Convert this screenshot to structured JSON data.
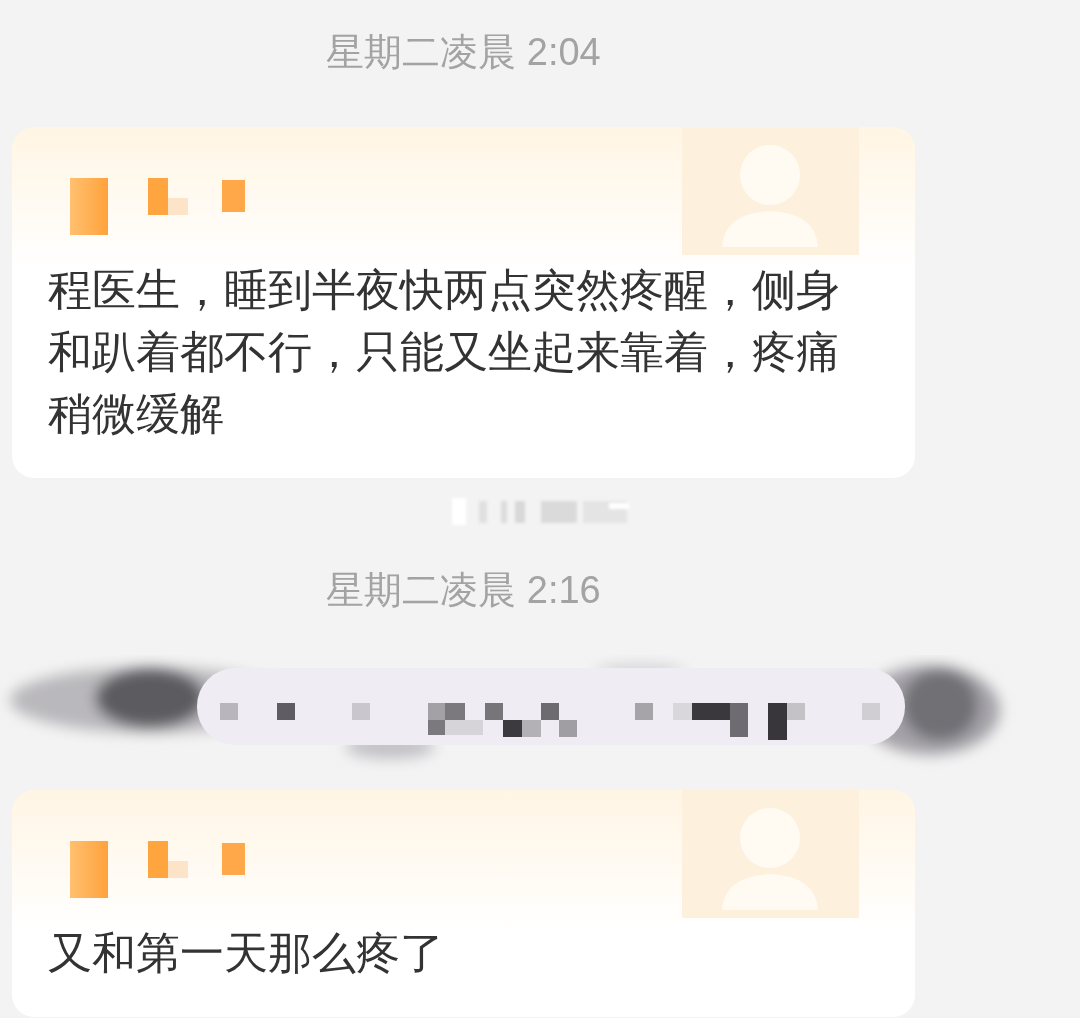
{
  "chat": {
    "items": [
      {
        "kind": "timestamp",
        "text": "星期二凌晨 2:04"
      },
      {
        "kind": "message",
        "text": "程医生，睡到半夜快两点突然疼醒，侧身和趴着都不行，只能又坐起来靠着，疼痛稍微缓解"
      },
      {
        "kind": "redacted_notice"
      },
      {
        "kind": "timestamp",
        "text": "星期二凌晨 2:16"
      },
      {
        "kind": "redacted_message"
      },
      {
        "kind": "message",
        "text": "又和第一天那么疼了"
      }
    ]
  }
}
